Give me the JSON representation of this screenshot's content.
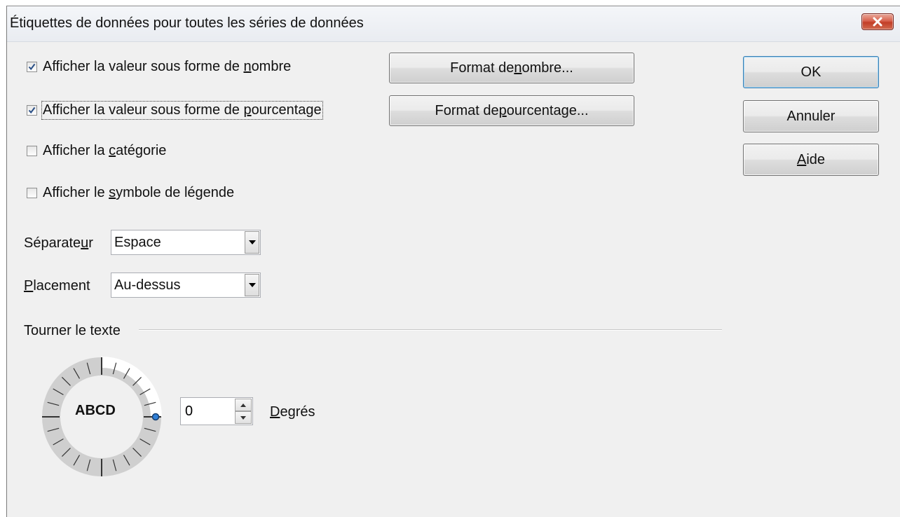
{
  "dialog": {
    "title": "Étiquettes de données pour toutes les séries de données"
  },
  "options": {
    "show_value_number": {
      "label_pre": "Afficher la valeur sous forme de ",
      "label_key": "n",
      "label_post": "ombre",
      "checked": true
    },
    "show_value_percent": {
      "label_pre": "Afficher la valeur sous forme de ",
      "label_key": "p",
      "label_post": "ourcentage",
      "checked": true
    },
    "show_category": {
      "label_pre": "Afficher la ",
      "label_key": "c",
      "label_post": "atégorie",
      "checked": false
    },
    "show_legend_symbol": {
      "label_pre": "Afficher le ",
      "label_key": "s",
      "label_post": "ymbole de légende",
      "checked": false
    }
  },
  "buttons": {
    "number_format": {
      "pre": "Format de ",
      "key": "n",
      "post": "ombre..."
    },
    "percent_format": {
      "pre": "Format de ",
      "key": "p",
      "post": "ourcentage..."
    },
    "ok": "OK",
    "cancel": "Annuler",
    "help": {
      "key": "A",
      "post": "ide"
    }
  },
  "separator": {
    "label_pre": "Séparate",
    "label_key": "u",
    "label_post": "r",
    "value": "Espace"
  },
  "placement": {
    "label_key": "P",
    "label_post": "lacement",
    "value": "Au-dessus"
  },
  "rotate": {
    "group_label": "Tourner le texte",
    "preview_text": "ABCD",
    "degrees_value": "0",
    "degrees_label_key": "D",
    "degrees_label_post": "egrés"
  },
  "colors": {
    "dialog_bg": "#f0f0f0",
    "close_button": "#c74a33",
    "default_button_border": "#3c7fb1",
    "dial_knob": "#2f7fd6"
  }
}
